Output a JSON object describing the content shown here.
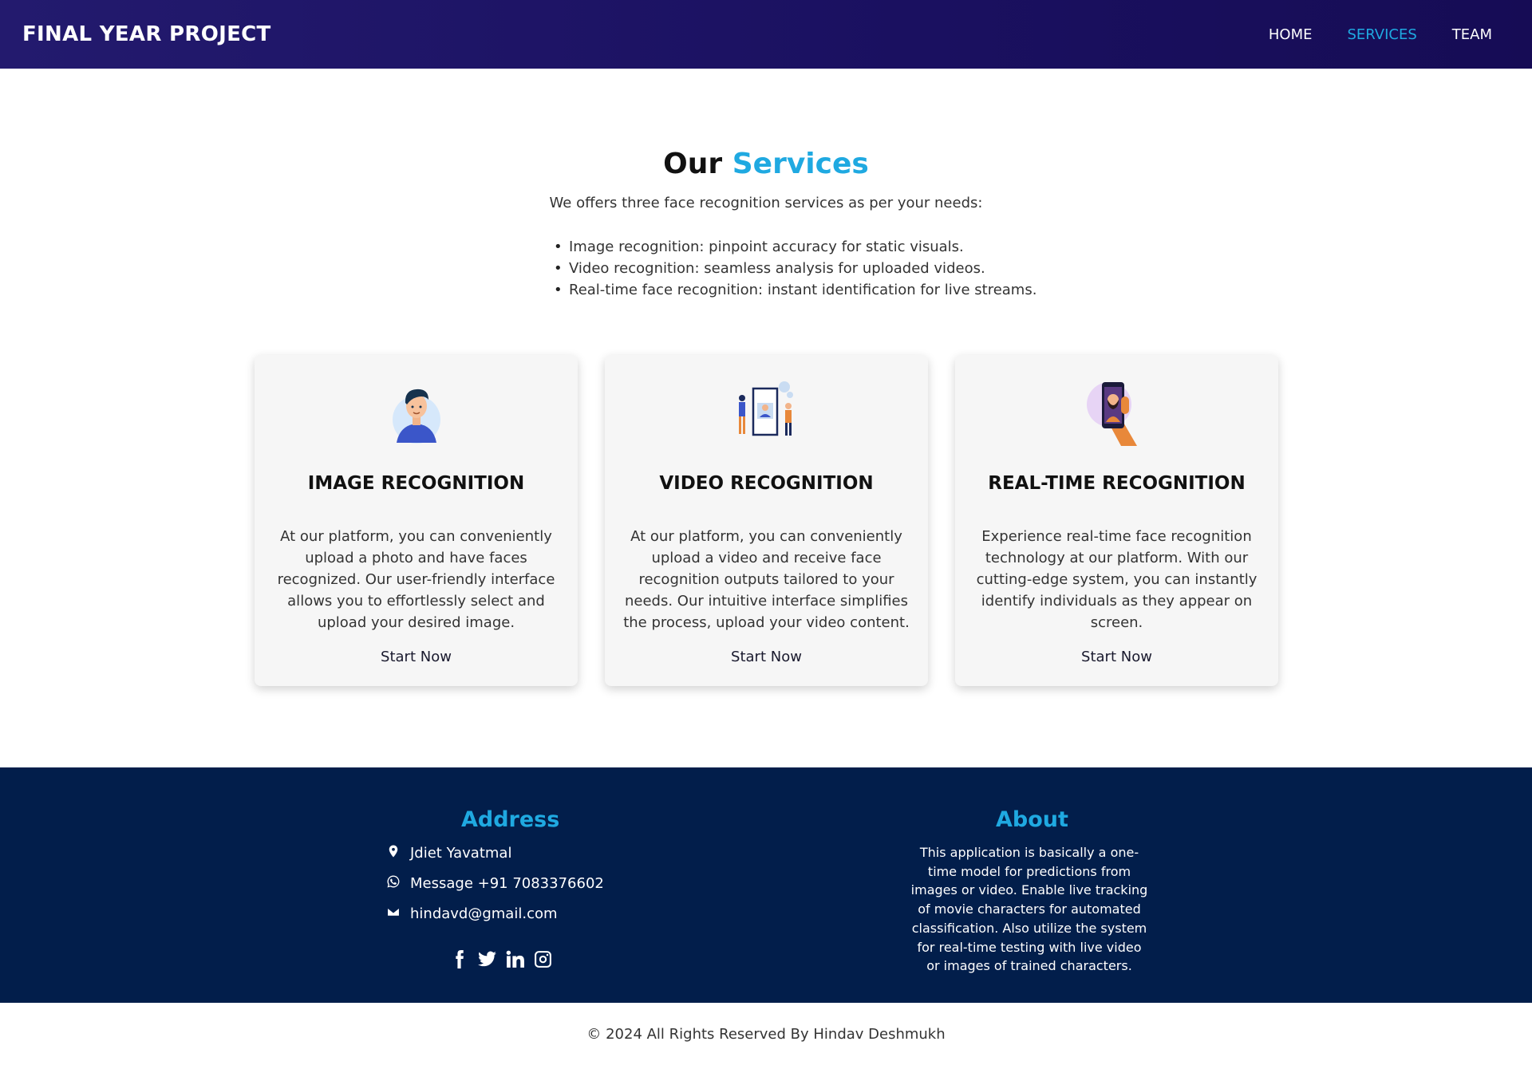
{
  "header": {
    "brand": "FINAL YEAR PROJECT",
    "nav": [
      {
        "label": "HOME",
        "active": false
      },
      {
        "label": "SERVICES",
        "active": true
      },
      {
        "label": "TEAM",
        "active": false
      }
    ]
  },
  "intro": {
    "title_prefix": "Our",
    "title_accent": "Services",
    "lead": "We offers three face recognition services as per your needs:",
    "bullets": [
      "Image recognition: pinpoint accuracy for static visuals.",
      "Video recognition: seamless analysis for uploaded videos.",
      "Real-time face recognition: instant identification for live streams."
    ]
  },
  "cards": [
    {
      "icon": "person-avatar-icon",
      "title": "IMAGE RECOGNITION",
      "text": "At our platform, you can conveniently upload a photo and have faces recognized. Our user-friendly interface allows you to effortlessly select and upload your desired image.",
      "cta": "Start Now"
    },
    {
      "icon": "video-frame-people-icon",
      "title": "VIDEO RECOGNITION",
      "text": "At our platform, you can conveniently upload a video and receive face recognition outputs tailored to your needs. Our intuitive interface simplifies the process, upload your video content.",
      "cta": "Start Now"
    },
    {
      "icon": "phone-face-scan-icon",
      "title": "REAL-TIME RECOGNITION",
      "text": "Experience real-time face recognition technology at our platform. With our cutting-edge system, you can instantly identify individuals as they appear on screen.",
      "cta": "Start Now"
    }
  ],
  "footer": {
    "address_title": "Address",
    "location": "Jdiet Yavatmal",
    "phone": "Message +91 7083376602",
    "email": "hindavd@gmail.com",
    "about_title": "About",
    "about_text": "This application is basically a one-time model for predictions from images or video. Enable live tracking of movie characters for automated classification. Also utilize the system for real-time testing with live video or images of trained characters.",
    "socials": [
      "facebook-icon",
      "twitter-icon",
      "linkedin-icon",
      "instagram-icon"
    ]
  },
  "copyright": "© 2024 All Rights Reserved By Hindav Deshmukh",
  "colors": {
    "accent": "#1fa9e1",
    "header_bg": "#1a1060",
    "footer_bg": "#021e4b"
  }
}
